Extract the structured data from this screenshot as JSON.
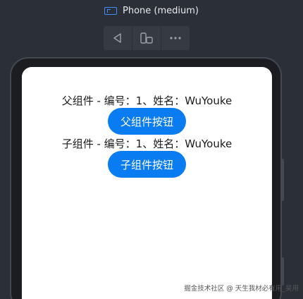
{
  "device": {
    "label": "Phone (medium)",
    "icons": {
      "device": "phone-device-icon",
      "rotate": "triangle-left-icon",
      "foldable": "multi-device-icon",
      "more": "more-dots-icon"
    }
  },
  "parent": {
    "text_prefix": "父组件 - 编号：1、姓名：WuYouke",
    "button_label": "父组件按钮"
  },
  "child": {
    "text_prefix": "子组件 - 编号：1、姓名：WuYouke",
    "button_label": "子组件按钮"
  },
  "watermark": "掘金技术社区 @ 天生我材必有用_吴用",
  "colors": {
    "accent": "#0a7cf2",
    "background": "#2b2f37"
  }
}
